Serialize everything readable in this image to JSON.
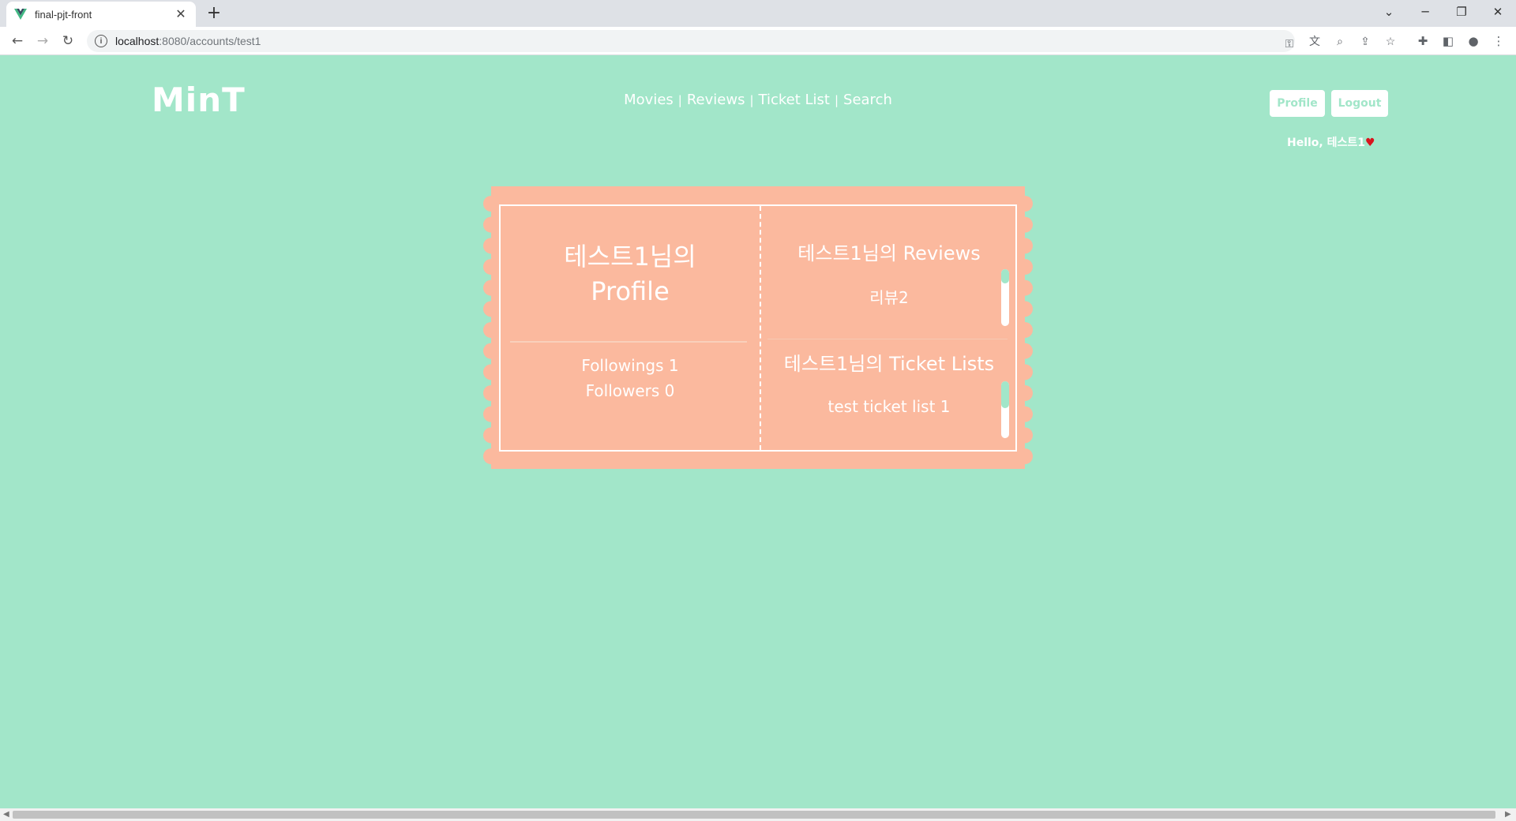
{
  "browser": {
    "tab_title": "final-pjt-front",
    "url_host": "localhost",
    "url_path": ":8080/accounts/test1"
  },
  "site": {
    "logo": "MinT",
    "nav": [
      "Movies",
      "Reviews",
      "Ticket List",
      "Search"
    ],
    "nav_sep": "|",
    "profile_button": "Profile",
    "logout_button": "Logout",
    "hello": "Hello, 테스트1"
  },
  "profile": {
    "title_line1": "테스트1님의",
    "title_line2": "Profile",
    "followings": "Followings 1",
    "followers": "Followers 0",
    "reviews_title": "테스트1님의 Reviews",
    "review_item": "리뷰2",
    "ticket_lists_title": "테스트1님의 Ticket Lists",
    "ticket_item": "test ticket list 1"
  },
  "colors": {
    "background": "#a2e6c9",
    "ticket": "#fbb99e",
    "text": "#ffffff"
  }
}
